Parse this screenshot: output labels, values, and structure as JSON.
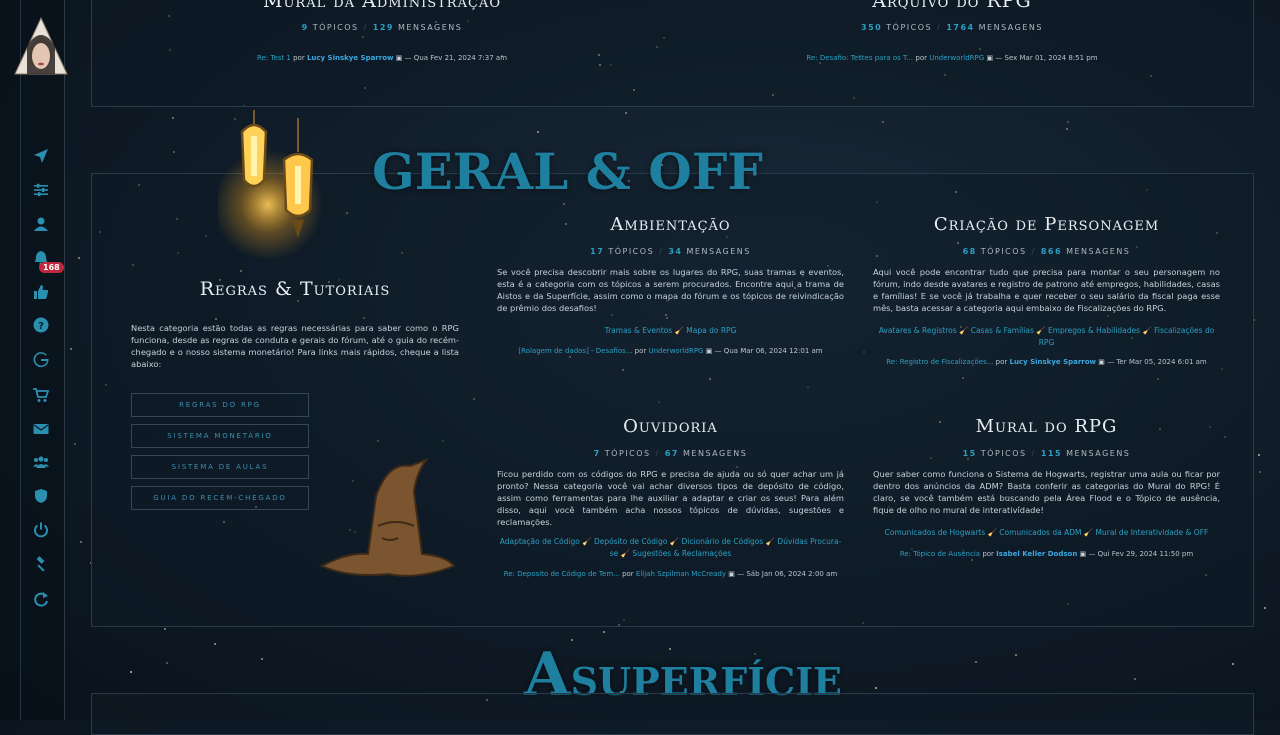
{
  "sidebar": {
    "notification_count": "168",
    "icons": [
      "send-icon",
      "sliders-icon",
      "user-icon",
      "bell-icon",
      "thumbs-up-icon",
      "question-icon",
      "g-icon",
      "cart-icon",
      "envelope-icon",
      "users-icon",
      "shield-icon",
      "power-icon",
      "gavel-icon",
      "refresh-icon"
    ]
  },
  "top_forums": [
    {
      "title": "Mural da Administração",
      "topics": "9",
      "topics_label": "TÓPICOS",
      "posts": "129",
      "posts_label": "MENSAGENS",
      "last_post": {
        "link": "Re: Test 1",
        "by": "por",
        "user": "Lucy Sinskye Sparrow",
        "date": "— Qua Fev 21, 2024 7:37 am"
      }
    },
    {
      "title": "Arquivo do RPG",
      "topics": "350",
      "topics_label": "TÓPICOS",
      "posts": "1764",
      "posts_label": "MENSAGENS",
      "last_post": {
        "link": "Re: Desafio: Testes para os T...",
        "by": "por",
        "user": "UnderworldRPG",
        "date": "— Sex Mar 01, 2024 8:51 pm"
      }
    }
  ],
  "section_geral": {
    "heading": "GERAL & OFF",
    "intro": {
      "title": "Regras & Tutoriais",
      "text": "Nesta categoria estão todas as regras necessárias para saber como o RPG funciona, desde as regras de conduta e gerais do fórum, até o guia do recém-chegado e o nosso sistema monetário! Para links mais rápidos, cheque a lista abaixo:",
      "buttons": [
        "REGRAS DO RPG",
        "SISTEMA MONETÁRIO",
        "SISTEMA DE AULAS",
        "GUIA DO RECÉM-CHEGADO"
      ]
    },
    "forums": [
      {
        "title": "Ambientação",
        "topics": "17",
        "topics_label": "TÓPICOS",
        "posts": "34",
        "posts_label": "MENSAGENS",
        "desc": "Se você precisa descobrir mais sobre os lugares do RPG, suas tramas e eventos, esta é a categoria com os tópicos a serem procurados. Encontre aqui a trama de Aistos e da Superfície, assim como o mapa do fórum e os tópicos de reivindicação de prêmio dos desafios!",
        "sublinks": "Tramas & Eventos 🧹 Mapa do RPG",
        "last_post": {
          "link": "[Rolagem de dados] - Desafios...",
          "by": "por",
          "user": "UnderworldRPG",
          "date": "— Qua Mar 06, 2024 12:01 am"
        }
      },
      {
        "title": "Criação de Personagem",
        "topics": "68",
        "topics_label": "TÓPICOS",
        "posts": "866",
        "posts_label": "MENSAGENS",
        "desc": "Aqui você pode encontrar tudo que precisa para montar o seu personagem no fórum, indo desde avatares e registro de patrono até empregos, habilidades, casas e famílias! E se você já trabalha e quer receber o seu salário da fiscal paga esse mês, basta acessar a categoria aqui embaixo de Fiscalizações do RPG.",
        "sublinks": "Avatares & Registros 🧹 Casas & Famílias 🧹 Empregos & Habilidades 🧹 Fiscalizações do RPG",
        "last_post": {
          "link": "Re: Registro de Fiscalizações...",
          "by": "por",
          "user": "Lucy Sinskye Sparrow",
          "date": "— Ter Mar 05, 2024 6:01 am"
        }
      },
      {
        "title": "Ouvidoria",
        "topics": "7",
        "topics_label": "TÓPICOS",
        "posts": "67",
        "posts_label": "MENSAGENS",
        "desc": "Ficou perdido com os códigos do RPG e precisa de ajuda ou só quer achar um já pronto? Nessa categoria você vai achar diversos tipos de depósito de código, assim como ferramentas para lhe auxiliar a adaptar e criar os seus! Para além disso, aqui você também acha nossos tópicos de dúvidas, sugestões e reclamações.",
        "sublinks": "Adaptação de Código 🧹 Depósito de Código 🧹 Dicionário de Códigos 🧹 Dúvidas Procura-se 🧹 Sugestões & Reclamações",
        "last_post": {
          "link": "Re: Deposito de Código de Tem...",
          "by": "por",
          "user": "Elijah Szpilman McCready",
          "date": "— Sáb Jan 06, 2024 2:00 am"
        }
      },
      {
        "title": "Mural do RPG",
        "topics": "15",
        "topics_label": "TÓPICOS",
        "posts": "115",
        "posts_label": "MENSAGENS",
        "desc": "Quer saber como funciona o Sistema de Hogwarts, registrar uma aula ou ficar por dentro dos anúncios da ADM? Basta conferir as categorias do Mural do RPG! É claro, se você também está buscando pela Área Flood e o Tópico de ausência, fique de olho no mural de interatividade!",
        "sublinks": "Comunicados de Hogwarts 🧹 Comunicados da ADM 🧹 Mural de Interatividade & OFF",
        "last_post": {
          "link": "Re: Tópico de Ausência",
          "by": "por",
          "user": "Isabel Keller Dodson",
          "date": "— Qui Fev 29, 2024 11:50 pm"
        }
      }
    ]
  },
  "section_superficie": {
    "heading_cap": "A",
    "heading_rest": "SUPERFÍCIE"
  }
}
